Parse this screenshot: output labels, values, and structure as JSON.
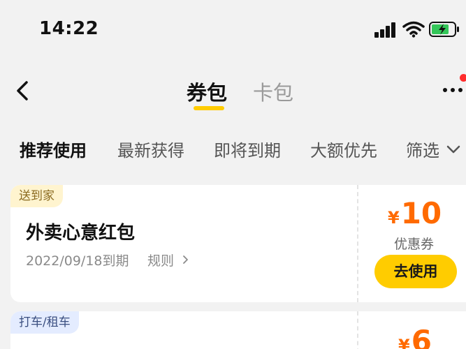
{
  "status_bar": {
    "time": "14:22"
  },
  "nav": {
    "back_icon": "chevron-left-icon",
    "tabs": [
      {
        "label": "券包",
        "active": true
      },
      {
        "label": "卡包",
        "active": false
      }
    ],
    "more_icon": "more-dots-icon",
    "accent": "#ffcc00",
    "notification_color": "#ff2d2d"
  },
  "filters": {
    "items": [
      {
        "label": "推荐使用",
        "active": true
      },
      {
        "label": "最新获得",
        "active": false
      },
      {
        "label": "即将到期",
        "active": false
      },
      {
        "label": "大额优先",
        "active": false
      }
    ],
    "filter_label": "筛选"
  },
  "coupons": [
    {
      "tag": "送到家",
      "title": "外卖心意红包",
      "expiry": "2022/09/18到期",
      "rule_label": "规则",
      "currency": "¥",
      "amount": "10",
      "type_label": "优惠券",
      "action_label": "去使用"
    },
    {
      "tag": "打车/租车",
      "currency": "¥",
      "amount": "6"
    }
  ],
  "colors": {
    "price": "#ff6a00",
    "button": "#ffcc00",
    "background": "#f2f2f2"
  }
}
